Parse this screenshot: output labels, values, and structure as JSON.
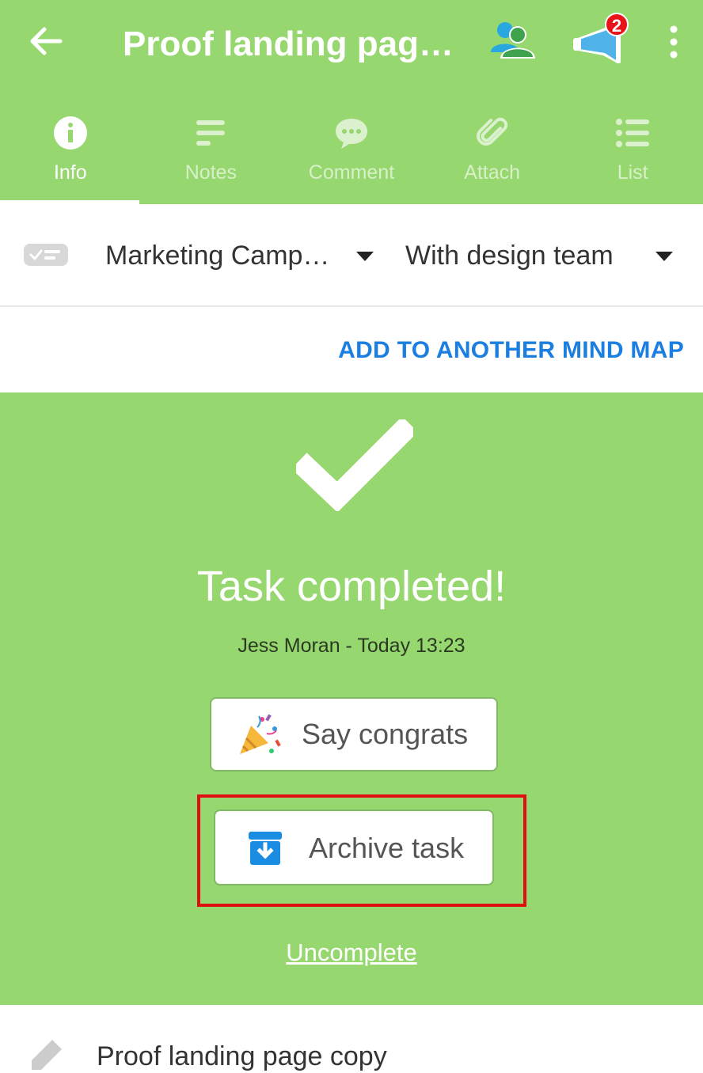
{
  "header": {
    "title": "Proof landing pag…",
    "back_icon": "arrow-left-icon",
    "team_icon": "people-icon",
    "announce_icon": "megaphone-icon",
    "notification_count": "2",
    "more_icon": "more-vertical-icon"
  },
  "tabs": [
    {
      "label": "Info",
      "icon": "info-icon",
      "active": true
    },
    {
      "label": "Notes",
      "icon": "notes-icon",
      "active": false
    },
    {
      "label": "Comment",
      "icon": "comment-icon",
      "active": false
    },
    {
      "label": "Attach",
      "icon": "paperclip-icon",
      "active": false
    },
    {
      "label": "List",
      "icon": "list-icon",
      "active": false
    }
  ],
  "selectors": {
    "map": "Marketing Camp…",
    "node": "With design team"
  },
  "add_link": "ADD TO ANOTHER MIND MAP",
  "completed": {
    "title": "Task completed!",
    "meta": "Jess Moran - Today 13:23",
    "congrats_label": "Say congrats",
    "archive_label": "Archive task",
    "uncomplete_label": "Uncomplete"
  },
  "task": {
    "name": "Proof landing page copy"
  },
  "colors": {
    "accent_green": "#97d76f",
    "link_blue": "#1a7fe0",
    "highlight_red": "#e01010"
  }
}
